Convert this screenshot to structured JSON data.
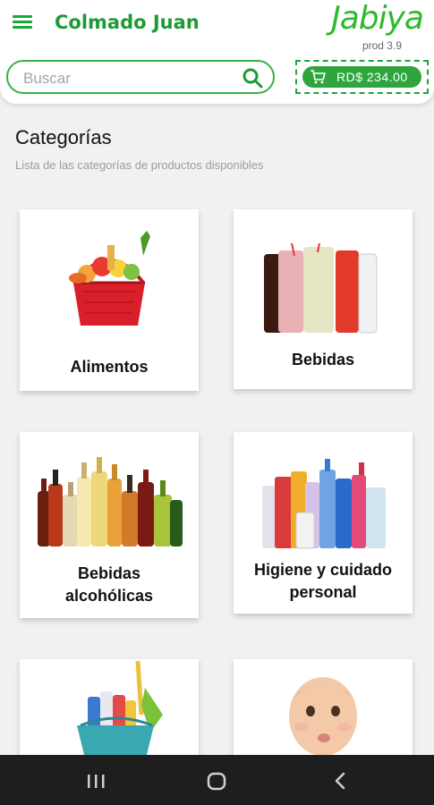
{
  "header": {
    "store_name": "Colmado Juan",
    "logo_text": "Jabiya",
    "version": "prod 3.9",
    "menu_icon": "hamburger-menu-icon"
  },
  "search": {
    "placeholder": "Buscar",
    "icon": "search-icon"
  },
  "cart": {
    "amount": "RD$ 234.00",
    "icon": "shopping-cart-icon"
  },
  "categories_section": {
    "title": "Categorías",
    "subtitle": "Lista de las categorías de productos disponibles"
  },
  "categories": [
    {
      "label": "Alimentos",
      "image": "food-basket-image"
    },
    {
      "label": "Bebidas",
      "image": "drinks-glasses-image"
    },
    {
      "label": "Bebidas\nalcohólicas",
      "label_line1": "Bebidas",
      "label_line2": "alcohólicas",
      "image": "alcohol-bottles-image"
    },
    {
      "label": "Higiene y cuidado personal",
      "label_line1": "Higiene y cuidado",
      "label_line2": "personal",
      "image": "hygiene-products-image"
    },
    {
      "label": "",
      "image": "cleaning-bucket-image"
    },
    {
      "label": "",
      "image": "baby-image"
    }
  ],
  "colors": {
    "brand_green": "#2fa63d",
    "background": "#f1f1f1",
    "navbar": "#1e1e1e"
  },
  "system_nav": {
    "recents_icon": "recent-apps-icon",
    "home_icon": "home-icon",
    "back_icon": "back-icon"
  }
}
